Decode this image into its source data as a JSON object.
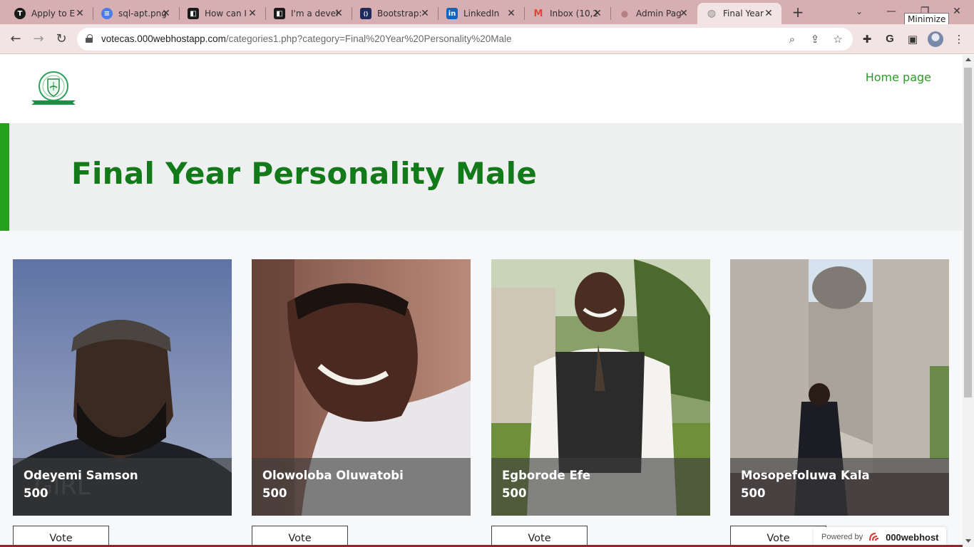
{
  "browser": {
    "tabs": [
      {
        "title": "Apply to E",
        "favicon": "T",
        "favicon_color": "#1a1a1a"
      },
      {
        "title": "sql-apt.png",
        "favicon": "≡",
        "favicon_color": "#4a7de8"
      },
      {
        "title": "How can I",
        "favicon": "◧",
        "favicon_color": "#1a1a1a"
      },
      {
        "title": "I'm a devel",
        "favicon": "◧",
        "favicon_color": "#1a1a1a"
      },
      {
        "title": "Bootstrap:",
        "favicon": "⟨⟩",
        "favicon_color": "#1f2b5a"
      },
      {
        "title": "LinkedIn",
        "favicon": "in",
        "favicon_color": "#0a66c2"
      },
      {
        "title": "Inbox (10,2",
        "favicon": "M",
        "favicon_color": "#ea4335"
      },
      {
        "title": "Admin Pag",
        "favicon": "●",
        "favicon_color": "#c9a0a3"
      },
      {
        "title": "Final Year",
        "favicon": "◍",
        "favicon_color": "#8a8a8a"
      }
    ],
    "tooltip": "Minimize",
    "url_host": "votecas.000webhostapp.com",
    "url_path": "/categories1.php?category=Final%20Year%20Personality%20Male"
  },
  "site": {
    "home_link": "Home page",
    "page_title": "Final Year Personality Male",
    "accent_color": "#27a01d",
    "title_color": "#137a1a"
  },
  "candidates": [
    {
      "name": "Odeyemi Samson",
      "votes": "500",
      "vote_label": "Vote"
    },
    {
      "name": "Olowoloba Oluwatobi",
      "votes": "500",
      "vote_label": "Vote"
    },
    {
      "name": "Egborode Efe",
      "votes": "500",
      "vote_label": "Vote"
    },
    {
      "name": "Mosopefoluwa Kala",
      "votes": "500",
      "vote_label": "Vote"
    }
  ],
  "footer_badge": {
    "label": "Powered by",
    "brand": "000webhost"
  }
}
